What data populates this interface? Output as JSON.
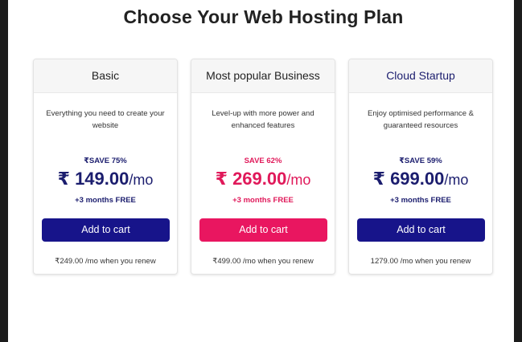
{
  "page": {
    "title": "Choose Your Web Hosting Plan"
  },
  "colors": {
    "navy": "#17148a",
    "pink": "#e91660",
    "frame": "#1c1c1c"
  },
  "plans": [
    {
      "name": "Basic",
      "description": "Everything you need to create your website",
      "save": "₹SAVE 75%",
      "currency": "₹",
      "price": "149.00",
      "unit": "/mo",
      "free": "+3 months FREE",
      "button": "Add to cart",
      "renew": "₹249.00 /mo when you renew"
    },
    {
      "name": "Most popular Business",
      "description": "Level-up with more power and enhanced features",
      "save": "SAVE 62%",
      "currency": "₹",
      "price": "269.00",
      "unit": "/mo",
      "free": "+3 months FREE",
      "button": "Add to cart",
      "renew": "₹499.00 /mo when you renew"
    },
    {
      "name": "Cloud Startup",
      "description": "Enjoy optimised performance & guaranteed resources",
      "save": "₹SAVE 59%",
      "currency": "₹",
      "price": "699.00",
      "unit": "/mo",
      "free": "+3 months FREE",
      "button": "Add to cart",
      "renew": "1279.00 /mo when you renew"
    }
  ]
}
